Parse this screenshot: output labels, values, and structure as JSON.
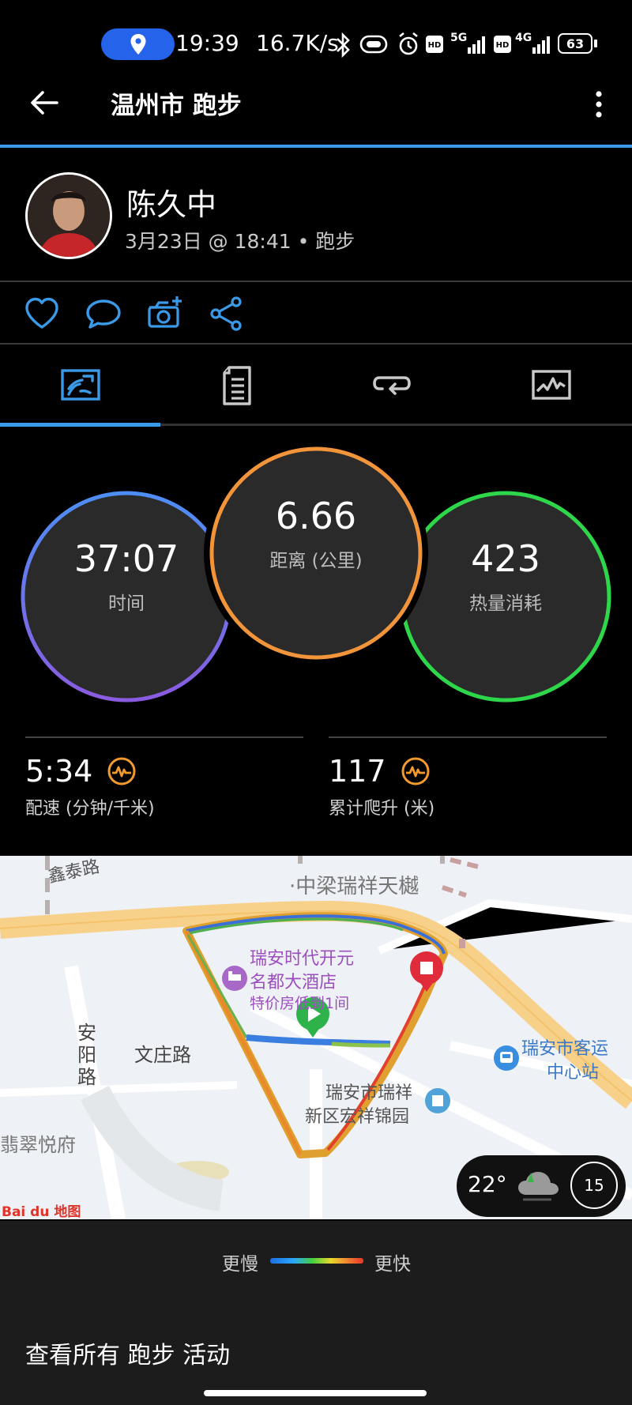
{
  "status_bar": {
    "time": "19:39",
    "net_speed": "16.7K/s",
    "signal1": "5G",
    "signal2": "4G",
    "battery": "63"
  },
  "appbar": {
    "title": "温州市 跑步"
  },
  "profile": {
    "name": "陈久中",
    "meta": "3月23日 @ 18:41 • 跑步"
  },
  "stats": {
    "time_value": "37:07",
    "time_label": "时间",
    "distance_value": "6.66",
    "distance_label": "距离 (公里)",
    "calories_value": "423",
    "calories_label": "热量消耗",
    "pace_value": "5:34",
    "pace_label": "配速 (分钟/千米)",
    "climb_value": "117",
    "climb_label": "累计爬升 (米)"
  },
  "colors": {
    "accent": "#3b9ae8",
    "time_ring_top": "#4d8ef5",
    "time_ring_bottom": "#8a5be0",
    "distance_ring": "#f2943a",
    "calories_ring": "#2ed64a",
    "metric_icon": "#f29a2e"
  },
  "map": {
    "labels": {
      "road1": "鑫泰路",
      "poi1": "·中梁瑞祥天樾",
      "hotel_line1": "瑞安时代开元",
      "hotel_line2": "名都大酒店",
      "hotel_line3": "特价房低到1间",
      "road2": "文庄路",
      "road3": "安阳路",
      "poi2_line1": "瑞安市瑞祥",
      "poi2_line2": "新区宏祥锦园",
      "station_line1": "瑞安市客运",
      "station_line2": "中心站",
      "poi3": "翡翠悦府",
      "logo": "Bai du 地图"
    },
    "weather_temp": "22°",
    "weather_badge": "15"
  },
  "legend": {
    "slow": "更慢",
    "fast": "更快"
  },
  "footer": {
    "view_all": "查看所有 跑步 活动"
  }
}
